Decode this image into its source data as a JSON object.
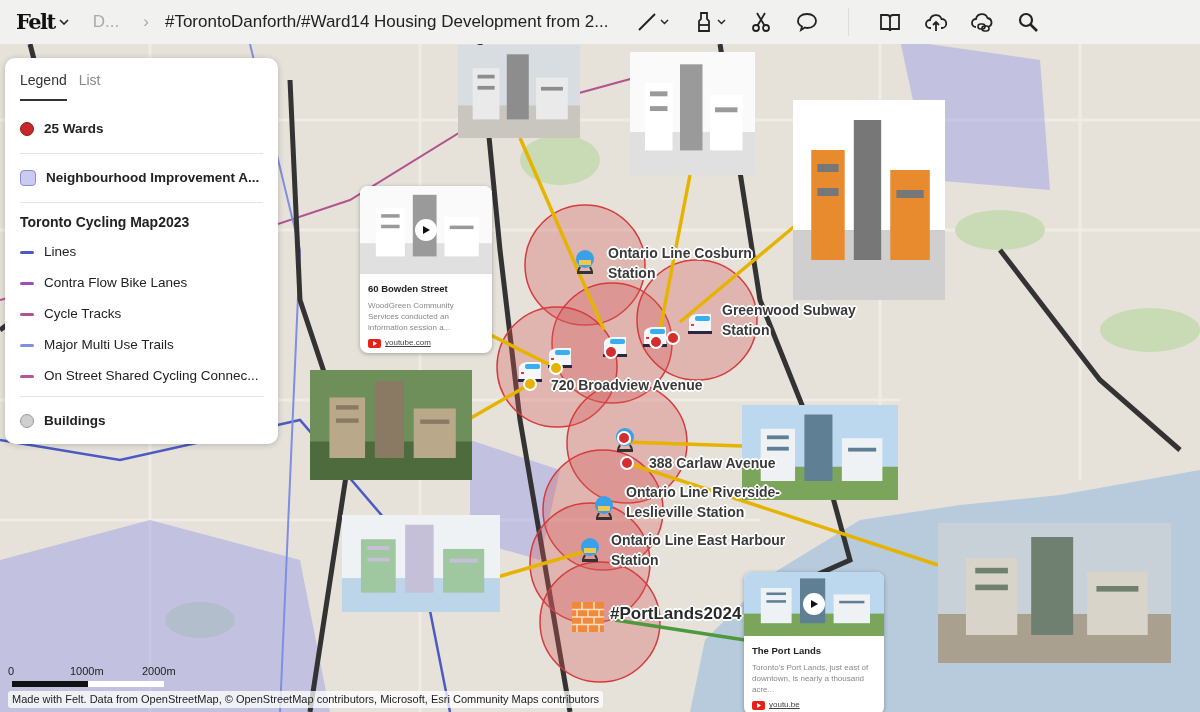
{
  "header": {
    "logo": "Felt",
    "breadcrumb_parent": "D...",
    "separator": "›",
    "title": "#TorontoDanforth/#Ward14 Housing Development from 2..."
  },
  "toolbar": [
    {
      "kind": "line",
      "dropdown": true
    },
    {
      "kind": "text",
      "dropdown": true
    },
    {
      "kind": "scissors"
    },
    {
      "kind": "comment"
    },
    {
      "kind": "divider"
    },
    {
      "kind": "book"
    },
    {
      "kind": "upload"
    },
    {
      "kind": "cloud-link"
    },
    {
      "kind": "search"
    }
  ],
  "legend": {
    "tabs": [
      {
        "label": "Legend",
        "selected": true
      },
      {
        "label": "List",
        "selected": false
      }
    ],
    "items": [
      {
        "kind": "point",
        "label": "25 Wards",
        "color": "#c62828"
      },
      {
        "kind": "divider"
      },
      {
        "kind": "area",
        "label": "Neighbourhood Improvement A...",
        "color": "#c9ccf0"
      },
      {
        "kind": "divider"
      },
      {
        "kind": "group",
        "label": "Toronto Cycling Map2023"
      },
      {
        "kind": "line",
        "label": "Lines",
        "color": "#4b5bc4"
      },
      {
        "kind": "line",
        "label": "Contra Flow Bike Lanes",
        "color": "#9c4fb8"
      },
      {
        "kind": "line",
        "label": "Cycle Tracks",
        "color": "#b2528f"
      },
      {
        "kind": "line",
        "label": "Major Multi Use Trails",
        "color": "#7f8ee0"
      },
      {
        "kind": "line",
        "label": "On Street Shared Cycling Connec...",
        "color": "#b8559a"
      },
      {
        "kind": "divider"
      },
      {
        "kind": "point",
        "label": "Buildings",
        "color": "#cfcfcf"
      }
    ]
  },
  "map": {
    "labels": [
      {
        "text": "Ontario Line Cosburn Station",
        "kind": "station"
      },
      {
        "text": "Greenwood Subway Station",
        "kind": "station"
      },
      {
        "text": "720 Broadview Avenue",
        "kind": "station"
      },
      {
        "text": "388 Carlaw Avenue",
        "kind": "station"
      },
      {
        "text": "Ontario Line Riverside-Leslieville Station",
        "kind": "station"
      },
      {
        "text": "Ontario Line East Harbour Station",
        "kind": "station"
      },
      {
        "text": "#PortLands2024",
        "kind": "title"
      }
    ],
    "markers": [
      {
        "kind": "metro"
      },
      {
        "kind": "tram"
      },
      {
        "kind": "tram"
      },
      {
        "kind": "tram"
      },
      {
        "kind": "tram"
      },
      {
        "kind": "tram"
      },
      {
        "kind": "dot",
        "color": "#d32f2f"
      },
      {
        "kind": "dot",
        "color": "#d32f2f"
      },
      {
        "kind": "dot",
        "color": "#d32f2f"
      },
      {
        "kind": "dot",
        "color": "#e6b400"
      },
      {
        "kind": "dot",
        "color": "#e6b400"
      },
      {
        "kind": "metro"
      },
      {
        "kind": "dot",
        "color": "#d32f2f"
      },
      {
        "kind": "dot",
        "color": "#d32f2f"
      },
      {
        "kind": "metro"
      },
      {
        "kind": "metro"
      },
      {
        "kind": "brick"
      }
    ],
    "video_cards": [
      {
        "title": "60 Bowden Street",
        "description": "WoodGreen Community Services conducted an information session a...",
        "source": "youtube.com"
      },
      {
        "title": "The Port Lands",
        "description": "Toronto's Port Lands, just east of downtown, is nearly a thousand acre...",
        "source": "youtu.be"
      }
    ]
  },
  "scale": {
    "labels": [
      "0",
      "1000m",
      "2000m"
    ]
  },
  "attribution": "Made with Felt. Data from OpenStreetMap, © OpenStreetMap contributors, Microsoft, Esri Community Maps contributors"
}
